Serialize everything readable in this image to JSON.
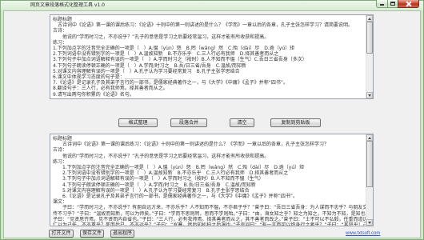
{
  "window": {
    "title": "网页文章段落格式化整理工具 v1.0"
  },
  "source_text": {
    "value": "标题标题\n　古诗词中《论语》第一课的课后练习：《论语》十则中的第一则讲述的是什么？《学而》一章以后的各章，孔子主张怎样学习？请简要说明。\n古诗：\n　　他说的“学而时习之，不亦说乎？”孔子的意思是学习之后要经常温习，这样才能有所收获和提高。\n练习：\n1.下列加点字的注音完全正确的一项是（　）A.愠（yùn）怒　B.罔（wǎng）然　C.殆（dài）尽　D.逾（yú）矩\n2.下列词语中没有错别字的一项是（　）A.温故知新　B.不亦乐乎　C.三人行必有我师　D.择其善者而从之\n3.下列句子中加点词语解释有误的一项是（　）A.学而时习之（按时）B.人不知而不愠（生气）C.吾日三省吾身（多次）\n4.下列句子朗读停顿正确的一项是（　）A.学而/时习之　B.吾/日三省/吾身　C.温故/而知新\n5.对课文内容理解有误的一项是（　）A.孔子认为学习要经常复习　B.孔子主张学思结合\n6.课文中体现学习态度的句子是：＿＿＿＿＿＿＿＿＿＿\n7.《论语》是记录孔子及其弟子言行的一部书，是儒家经典著作之一，与《大学》《中庸》《孟子》并称“四书”。\n8.翻译句子：三人行，必有我师焉。择其善者而从之。\n9.请写出两句你积累的《论语》名句。"
  },
  "actions": {
    "format_label": "格式整理",
    "merge_label": "段落合并",
    "clear_label": "清空",
    "copy_label": "复制到剪贴板"
  },
  "result_text": {
    "value": "标题标题\n　　古诗词中《论语》第一课的课后练习：《论语》十则中的第一则讲述的是什么？《学而》一章以后的各章，孔子主张怎样学习？\n古诗：\n　　他说的“学而时习之，不亦说乎？”孔子的意思是学习之后要经常温习，这样才能有所收获和提高。\n练习：\n　　1.下列加点字的注音完全正确的一项是（　）A.愠（yùn）怒　B.罔（wǎng）然　C.殆（dài）尽　D.逾（yú）矩\n　　2.下列词语中没有错别字的一项是（　）A.温故知新　B.不亦乐乎　C.三人行必有我师　D.择其善者而从之\n　　3.下列句子中加点词语解释有误的一项是（　）A.学而时习之（按时）B.人不知而不愠（生气）\n　　4.下列句子朗读停顿正确的一项是（　）A.学而/时习之　B.吾/日三省/吾身　C.温故/而知新\n　　5.对课文内容理解有误的一项是（　）A.孔子认为学习要经常复习　B.孔子主张学思结合\n　　6.《论语》是记录孔子及其弟子言行的一部书，是儒家经典著作之一，与《大学》《中庸》《孟子》并称“四书”。\n课文：\n　　子曰：“学而时习之，不亦说乎？有朋自远方来，不亦乐乎？人不知而不愠，不亦君子乎？”曾子曰：“吾日三省吾身：为人谋而不忠乎？与朋友交而不信乎？\n传不习乎？”子曰：“温故而知新，可以为师矣。”子曰：“学而不思则罔，思而不学则殆。”子曰：“由，诲女知之乎？知之为知之，不知为不知，是知也。”\n子曰：“见贤思齐焉，见不贤而内自省也。”子曰：“三人行，必有我师焉。择其善者而从之，其不善者而改之。”曾子曰：“士不可以不弘毅，任重而道远。\n仁以为己任，不亦重乎？死而后已，不亦远乎？”子曰：“岁寒，然后知松柏之后凋也。”子贡问曰：“有一言而可以终身行之者乎？”子曰：“其恕乎！己所不欲，勿施于人。”"
  },
  "footer": {
    "open_label": "打开文件",
    "save_label": "保存文件",
    "exit_label": "退出程序",
    "link_text": "www.txtsoft.com"
  },
  "icons": {
    "minimize": "minimize-icon",
    "maximize": "maximize-icon",
    "close": "close-icon",
    "scroll_up": "scroll-up-arrow-icon",
    "scroll_down": "scroll-down-arrow-icon"
  },
  "colors": {
    "frame": "#cfe6c7",
    "frame_edge": "#86aa80",
    "client": "#f0f0f0",
    "close_button": "#c9452f",
    "link": "#2f56c8",
    "text": "#333333"
  }
}
